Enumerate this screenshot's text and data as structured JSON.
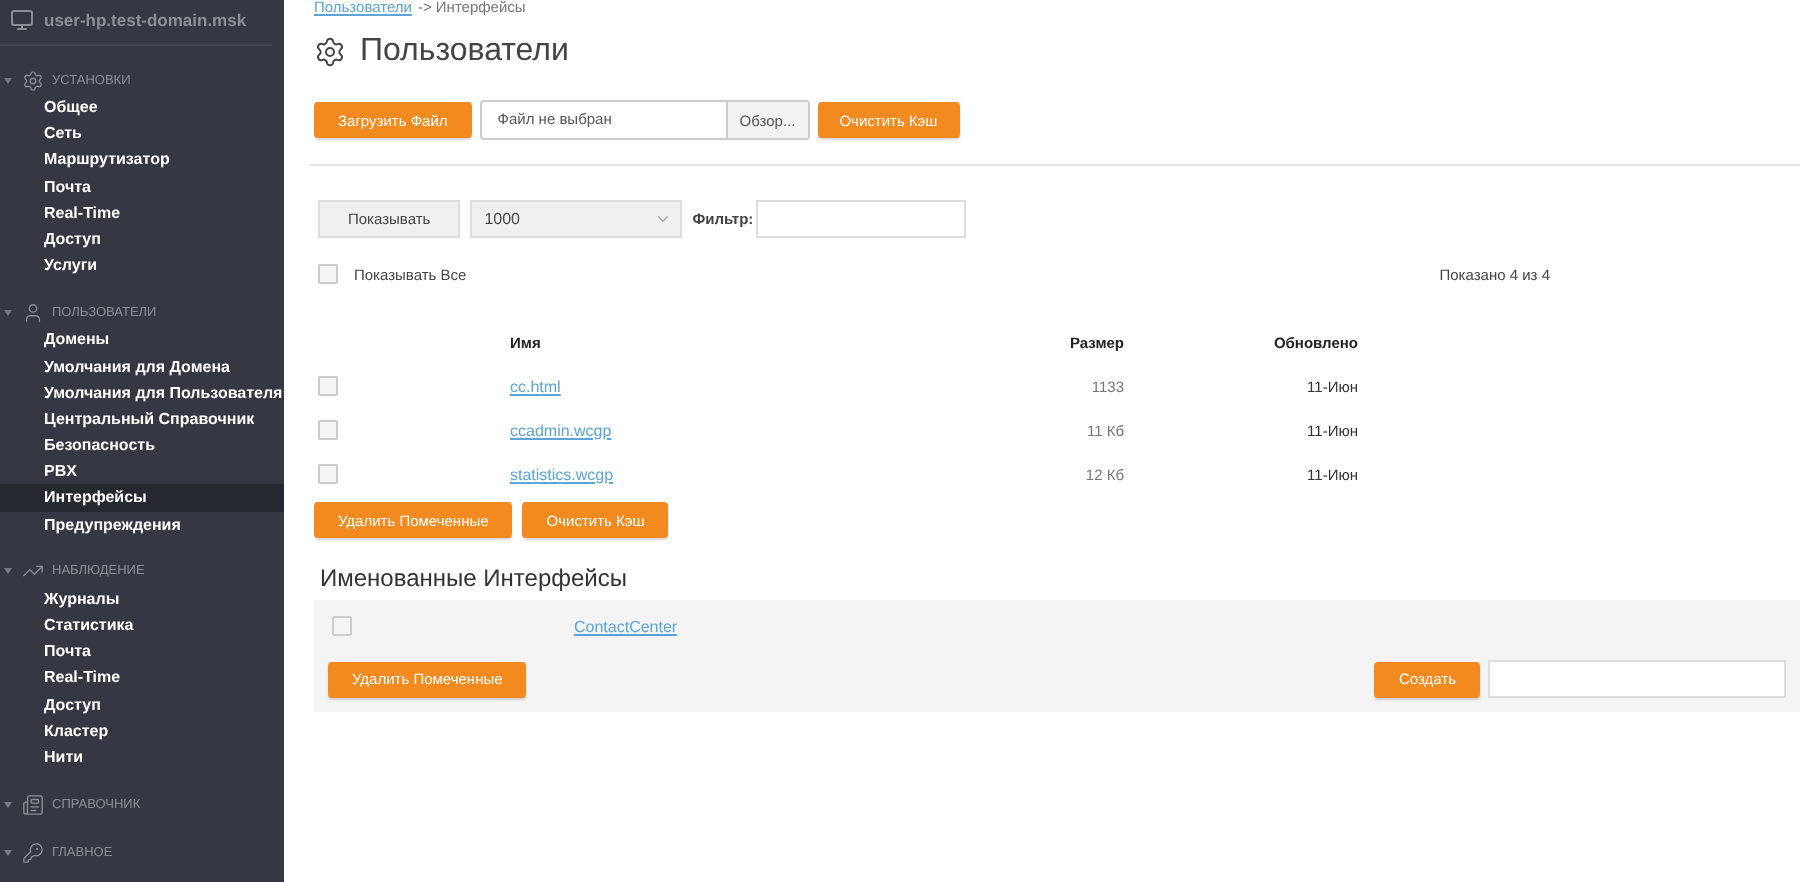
{
  "sidebar": {
    "host": "user-hp.test-domain.msk",
    "sections": [
      {
        "label": "УСТАНОВКИ",
        "items": [
          {
            "label": "Общее",
            "selected": false
          },
          {
            "label": "Сеть",
            "selected": false
          },
          {
            "label": "Маршрутизатор",
            "selected": false
          },
          {
            "label": "Почта",
            "selected": false
          },
          {
            "label": "Real-Time",
            "selected": false
          },
          {
            "label": "Доступ",
            "selected": false
          },
          {
            "label": "Услуги",
            "selected": false
          }
        ]
      },
      {
        "label": "ПОЛЬЗОВАТЕЛИ",
        "items": [
          {
            "label": "Домены",
            "selected": false
          },
          {
            "label": "Умолчания для Домена",
            "selected": false
          },
          {
            "label": "Умолчания для Пользователя",
            "selected": false
          },
          {
            "label": "Центральный Справочник",
            "selected": false
          },
          {
            "label": "Безопасность",
            "selected": false
          },
          {
            "label": "PBX",
            "selected": false
          },
          {
            "label": "Интерфейсы",
            "selected": true
          },
          {
            "label": "Предупреждения",
            "selected": false
          }
        ]
      },
      {
        "label": "НАБЛЮДЕНИЕ",
        "items": [
          {
            "label": "Журналы",
            "selected": false
          },
          {
            "label": "Статистика",
            "selected": false
          },
          {
            "label": "Почта",
            "selected": false
          },
          {
            "label": "Real-Time",
            "selected": false
          },
          {
            "label": "Доступ",
            "selected": false
          },
          {
            "label": "Кластер",
            "selected": false
          },
          {
            "label": "Нити",
            "selected": false
          }
        ]
      },
      {
        "label": "СПРАВОЧНИК"
      },
      {
        "label": "ГЛАВНОЕ"
      }
    ]
  },
  "breadcrumb": {
    "link": "Пользователи",
    "rest": "-> Интерфейсы"
  },
  "title": "Пользователи",
  "upload": {
    "upload_button": "Загрузить Файл",
    "file_name": "Файл не выбран",
    "browse_button": "Обзор...",
    "clear_button": "Очистить Кэш"
  },
  "controls": {
    "show_button": "Показывать",
    "page_size": "1000",
    "filter_label": "Фильтр:",
    "show_all": {
      "label": "Показывать Все",
      "checked": false
    },
    "count": "Показано 4 из 4"
  },
  "table": {
    "columns": [
      "Имя",
      "Размер",
      "Обновлено"
    ],
    "rows": [
      {
        "name": "cc.html",
        "size": "1133",
        "updated": "11-Июн",
        "checked": false
      },
      {
        "name": "ccadmin.wcgp",
        "size": "11 Кб",
        "updated": "11-Июн",
        "checked": false
      },
      {
        "name": "statistics.wcgp",
        "size": "12 Кб",
        "updated": "11-Июн",
        "checked": false
      }
    ],
    "buttons": [
      "Удалить Помеченные",
      "Очистить Кэш"
    ]
  },
  "named": {
    "title": "Именованные Интерфейсы",
    "rows": [
      {
        "name": "ContactCenter",
        "checked": false
      }
    ],
    "delete_button": "Удалить Помеченные",
    "create_button": "Создать"
  }
}
